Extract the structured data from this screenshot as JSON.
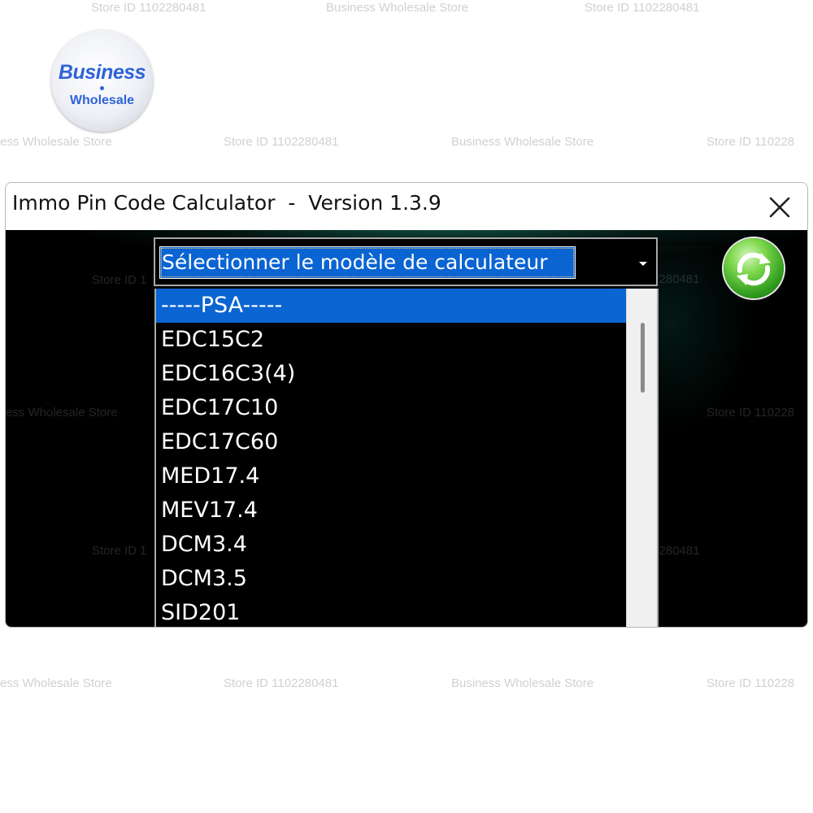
{
  "watermarks": {
    "store_id": "Store ID 1102280481",
    "store_name": "Business Wholesale Store",
    "store_id_cut": "Store ID 110228",
    "store_name_cut": "ess Wholesale Store",
    "store_id_left_cut": "Store ID 1"
  },
  "logo": {
    "main": "Business",
    "sub": "Wholesale"
  },
  "window": {
    "title": "Immo Pin Code Calculator  -  Version 1.3.9",
    "close_icon": "close-icon"
  },
  "combo": {
    "value": "Sélectionner le modèle de calculateur",
    "arrow_icon": "chevron-down-icon"
  },
  "refresh": {
    "icon": "refresh-icon",
    "color": "#2e9a1c"
  },
  "dropdown": {
    "items": [
      {
        "label": "-----PSA-----",
        "selected": true
      },
      {
        "label": "EDC15C2",
        "selected": false
      },
      {
        "label": "EDC16C3(4)",
        "selected": false
      },
      {
        "label": "EDC17C10",
        "selected": false
      },
      {
        "label": "EDC17C60",
        "selected": false
      },
      {
        "label": "MED17.4",
        "selected": false
      },
      {
        "label": "MEV17.4",
        "selected": false
      },
      {
        "label": "DCM3.4",
        "selected": false
      },
      {
        "label": "DCM3.5",
        "selected": false
      },
      {
        "label": "SID201",
        "selected": false
      }
    ]
  },
  "colors": {
    "selection": "#0a64d2",
    "client_background": "#000000",
    "title_background": "#ffffff"
  }
}
